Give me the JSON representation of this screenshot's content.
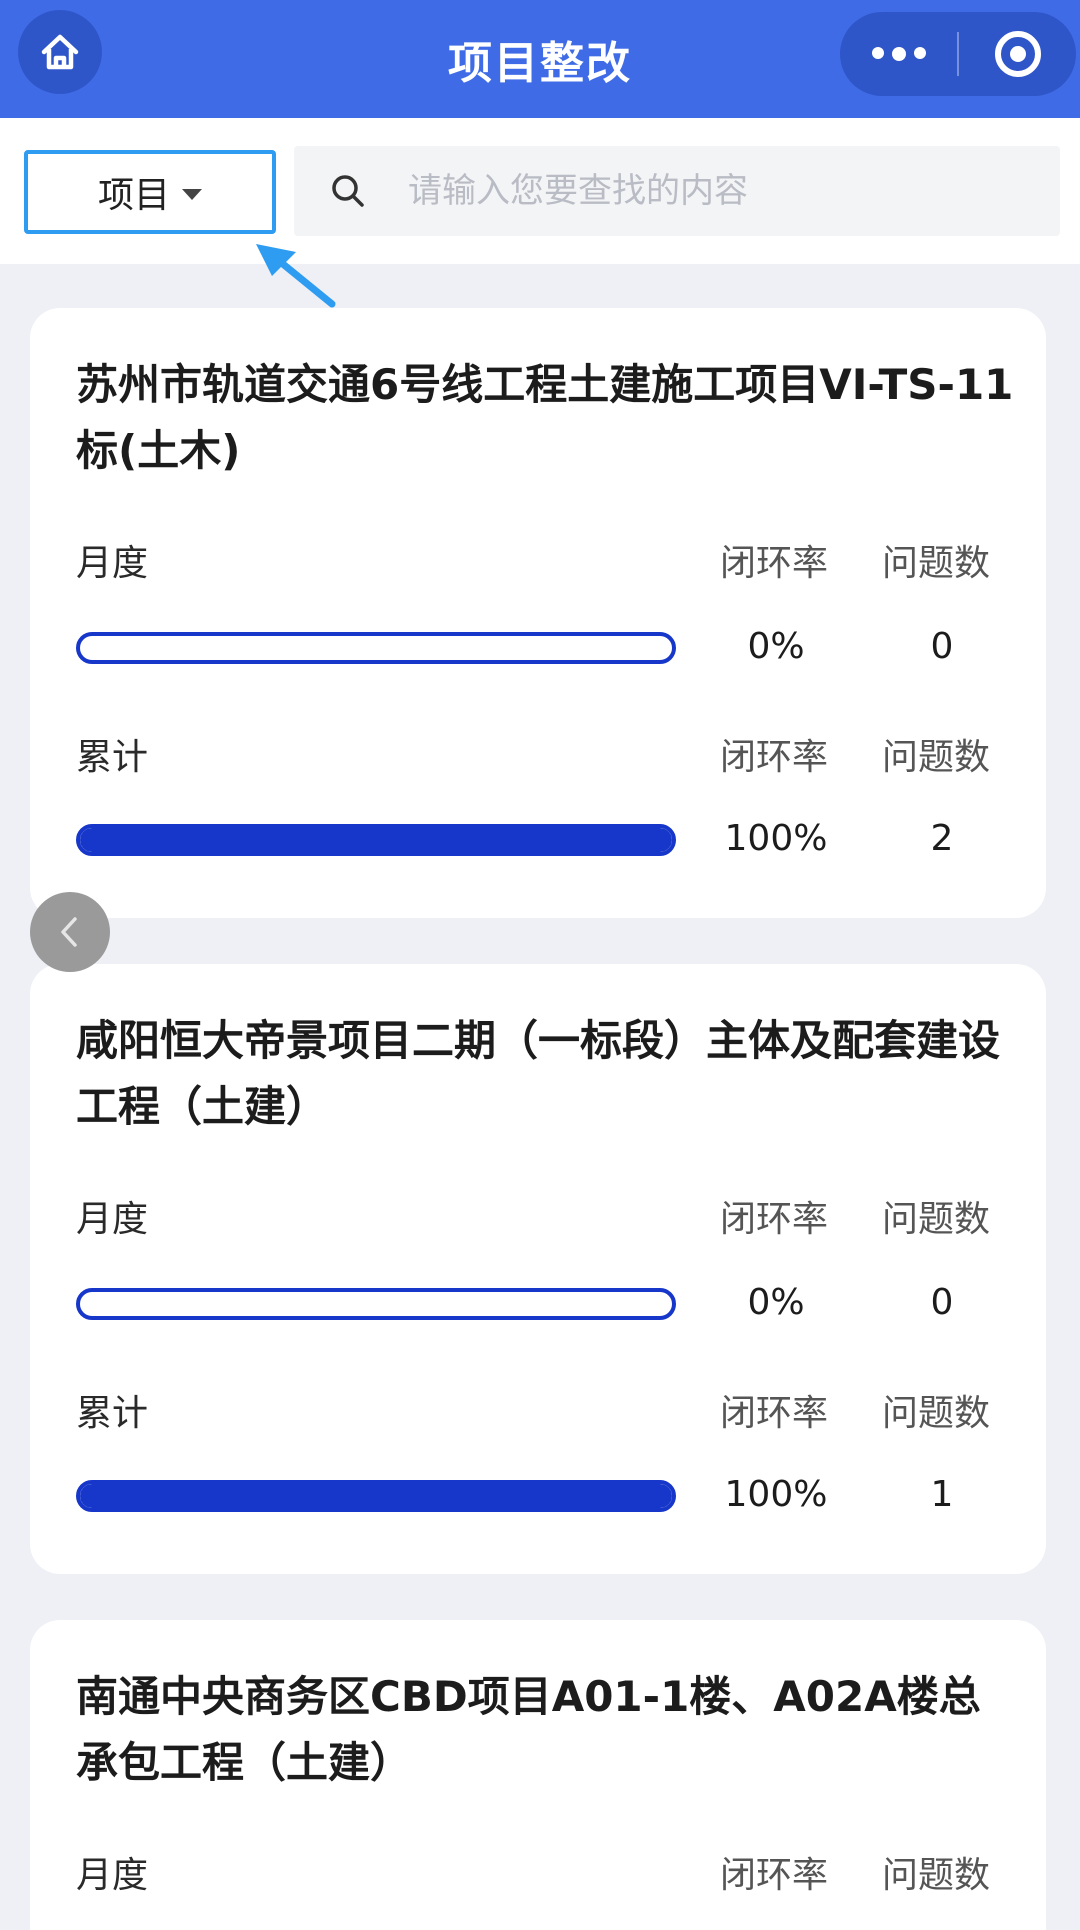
{
  "header": {
    "title": "项目整改"
  },
  "filter": {
    "dropdown_label": "项目",
    "search_placeholder": "请输入您要查找的内容"
  },
  "projects": [
    {
      "title": "苏州市轨道交通6号线工程土建施工项目VI-TS-11标(土木)",
      "monthly": {
        "label": "月度",
        "rate_header": "闭环率",
        "count_header": "问题数",
        "rate": "0%",
        "progress": 0,
        "count": "0"
      },
      "cumulative": {
        "label": "累计",
        "rate_header": "闭环率",
        "count_header": "问题数",
        "rate": "100%",
        "progress": 1,
        "count": "2"
      }
    },
    {
      "title": "咸阳恒大帝景项目二期（一标段）主体及配套建设工程（土建）",
      "monthly": {
        "label": "月度",
        "rate_header": "闭环率",
        "count_header": "问题数",
        "rate": "0%",
        "progress": 0,
        "count": "0"
      },
      "cumulative": {
        "label": "累计",
        "rate_header": "闭环率",
        "count_header": "问题数",
        "rate": "100%",
        "progress": 1,
        "count": "1"
      }
    },
    {
      "title": "南通中央商务区CBD项目A01-1楼、A02A楼总承包工程（土建）",
      "monthly": {
        "label": "月度",
        "rate_header": "闭环率",
        "count_header": "问题数"
      }
    }
  ],
  "colors": {
    "header_bg": "#3f6ce6",
    "accent": "#1637c9",
    "dropdown_border": "#2e9cf0"
  },
  "icons": {
    "home": "home-icon",
    "more": "more-dots-icon",
    "target": "target-icon",
    "search": "search-icon",
    "back": "chevron-left-icon"
  }
}
